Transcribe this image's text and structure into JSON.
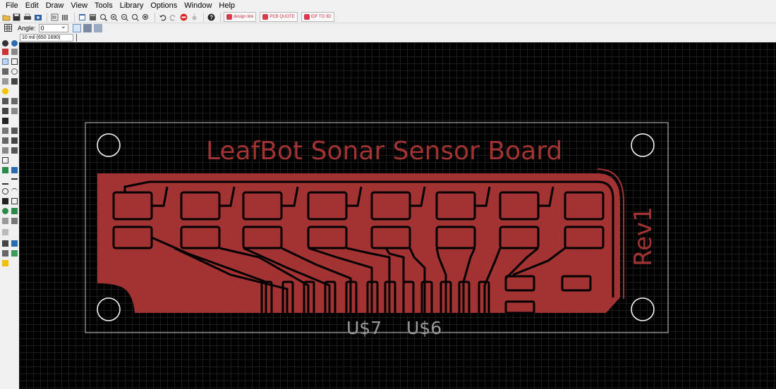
{
  "menubar": {
    "items": [
      "File",
      "Edit",
      "Draw",
      "View",
      "Tools",
      "Library",
      "Options",
      "Window",
      "Help"
    ]
  },
  "toolbar": {
    "promos": [
      {
        "icon": "design-link-icon",
        "label": "design link"
      },
      {
        "icon": "pcb-quote-icon",
        "label": "PCB QUOTE"
      },
      {
        "icon": "idf-3d-icon",
        "label": "IDF TO 3D"
      }
    ]
  },
  "params": {
    "angle_label": "Angle:",
    "angle_value": "0"
  },
  "command": {
    "coordinate_readout": "10 mil (650 1690)"
  },
  "board": {
    "title_text": "LeafBot Sonar Sensor Board",
    "rev_text": "Rev1",
    "part_labels": [
      "U$7",
      "U$6"
    ],
    "colors": {
      "canvas_bg": "#000000",
      "grid": "#1c1c1c",
      "copper": "#a33333",
      "outline": "#c8c8c8",
      "holes": "#ffffff",
      "part_label": "#9a9a9a"
    }
  }
}
